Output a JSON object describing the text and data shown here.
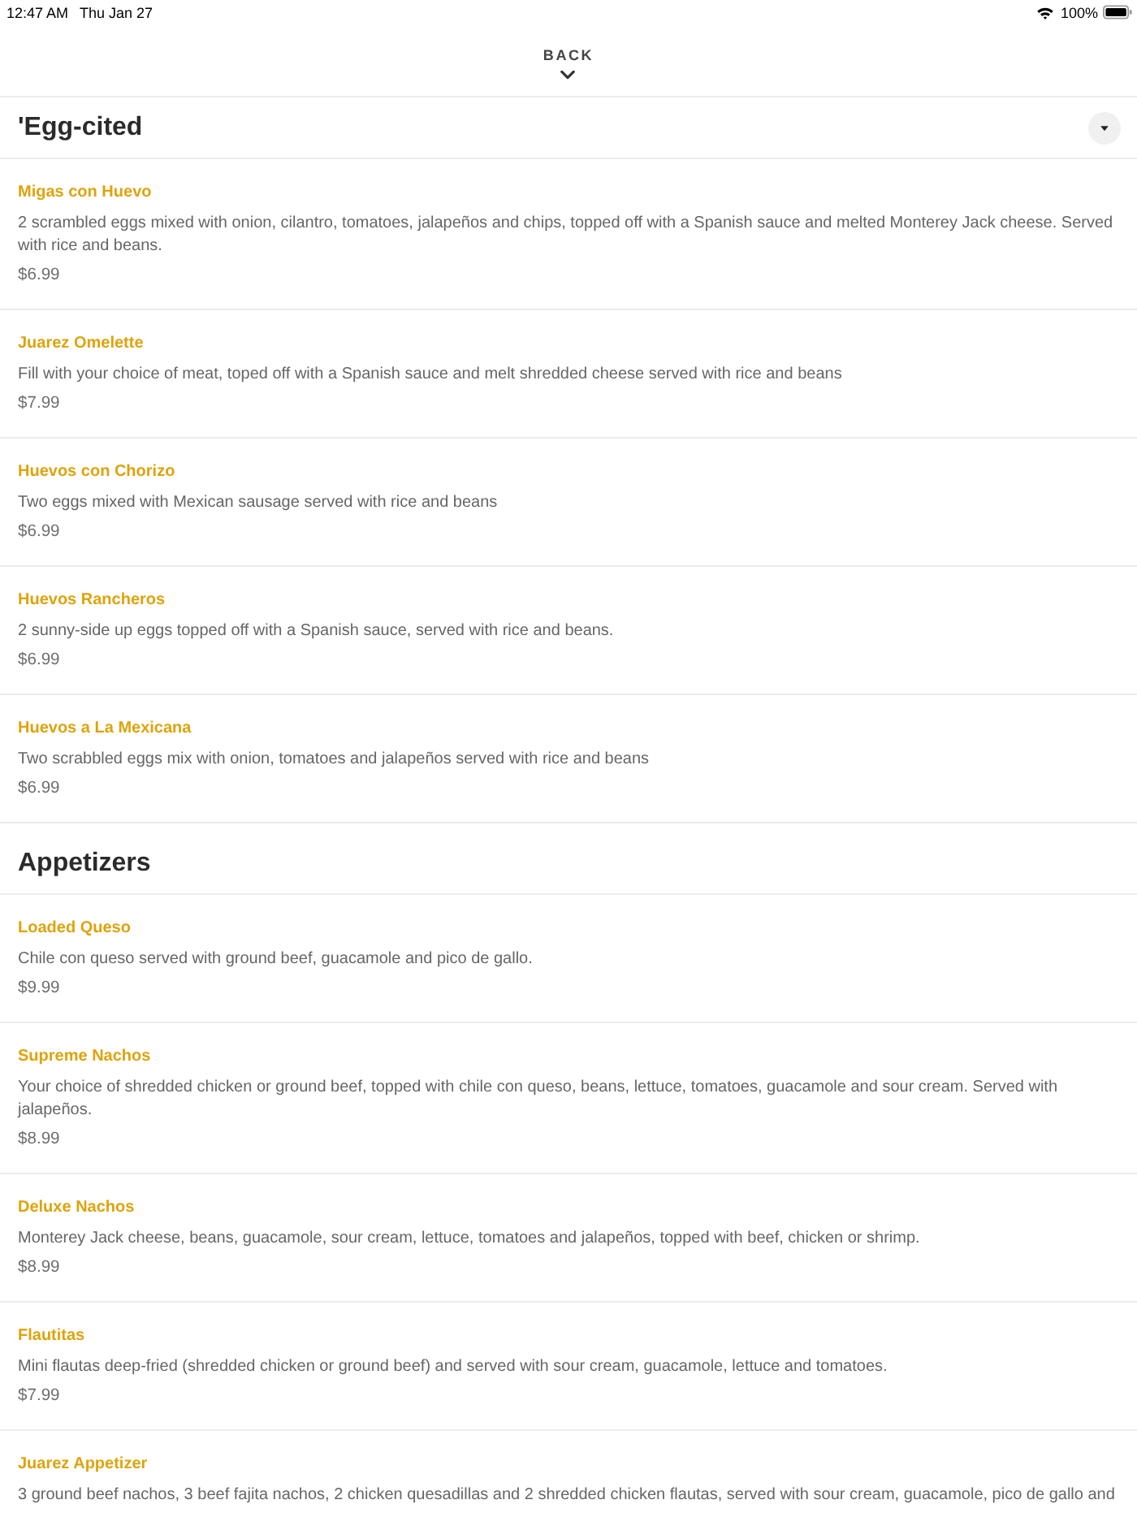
{
  "status_bar": {
    "time": "12:47 AM",
    "date": "Thu Jan 27",
    "battery": "100%"
  },
  "nav": {
    "back": "BACK"
  },
  "sections": [
    {
      "title": "'Egg-cited",
      "picker": true,
      "items": [
        {
          "name": "Migas con Huevo",
          "description": "2 scrambled eggs mixed with onion, cilantro, tomatoes, jalapeños and chips, topped off with a Spanish sauce and melted Monterey Jack cheese. Served with rice and beans.",
          "price": "$6.99"
        },
        {
          "name": "Juarez Omelette",
          "description": "Fill with your choice of meat, toped off with a Spanish sauce and melt shredded cheese served with rice and beans",
          "price": "$7.99"
        },
        {
          "name": "Huevos con Chorizo",
          "description": "Two eggs mixed with Mexican sausage served with rice and beans",
          "price": "$6.99"
        },
        {
          "name": "Huevos Rancheros",
          "description": "2 sunny-side up eggs topped off with a Spanish sauce, served with rice and beans.",
          "price": "$6.99"
        },
        {
          "name": "Huevos a La Mexicana",
          "description": "Two scrabbled eggs mix with onion, tomatoes and jalapeños served with rice and beans",
          "price": "$6.99"
        }
      ]
    },
    {
      "title": "Appetizers",
      "picker": false,
      "items": [
        {
          "name": "Loaded Queso",
          "description": "Chile con queso served with ground beef, guacamole and pico de gallo.",
          "price": "$9.99"
        },
        {
          "name": "Supreme Nachos",
          "description": "Your choice of shredded chicken or ground beef, topped with chile con queso, beans, lettuce, tomatoes, guacamole and sour cream. Served with jalapeños.",
          "price": "$8.99"
        },
        {
          "name": "Deluxe Nachos",
          "description": "Monterey Jack cheese, beans, guacamole, sour cream, lettuce, tomatoes and jalapeños, topped with beef, chicken or shrimp.",
          "price": "$8.99"
        },
        {
          "name": "Flautitas",
          "description": "Mini flautas deep-fried (shredded chicken or ground beef) and served with sour cream, guacamole, lettuce and tomatoes.",
          "price": "$7.99"
        },
        {
          "name": "Juarez Appetizer",
          "description": "3 ground beef nachos, 3 beef fajita nachos, 2 chicken quesadillas and 2 shredded chicken flautas, served with sour cream, guacamole, pico de gallo and"
        }
      ]
    }
  ]
}
